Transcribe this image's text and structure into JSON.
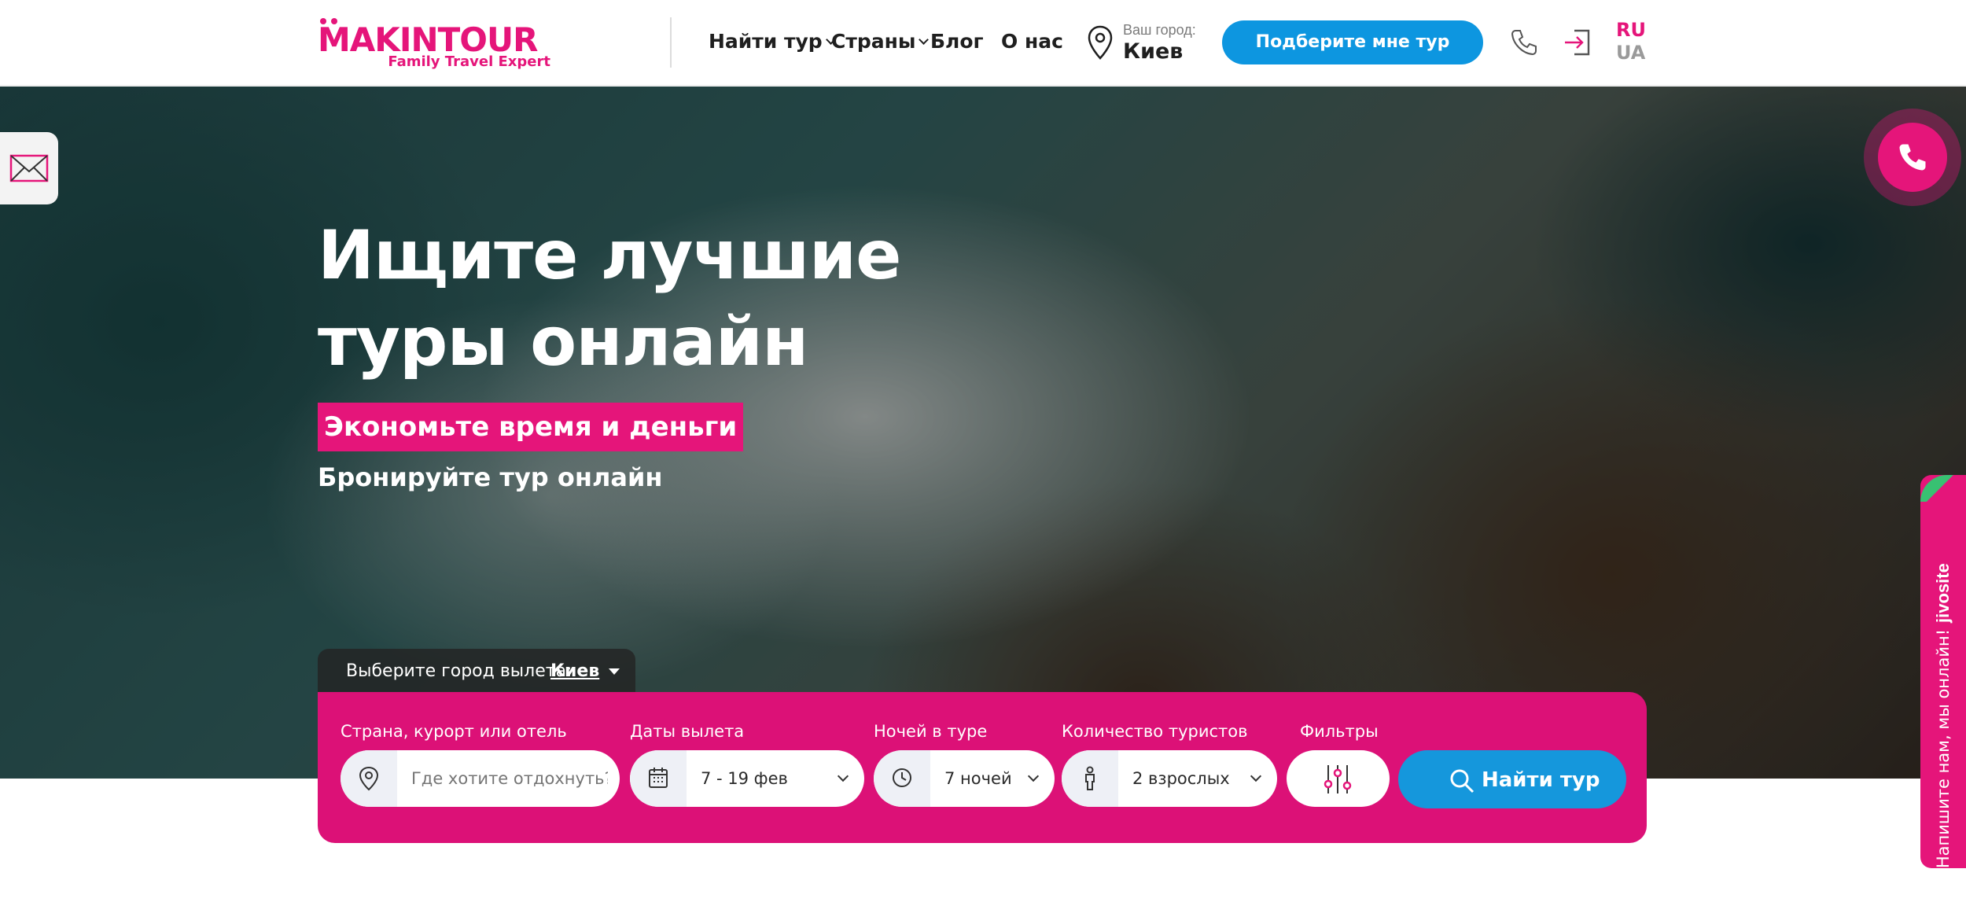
{
  "header": {
    "logo": {
      "name": "MAKINTOUR",
      "tagline": "Family Travel Expert"
    },
    "nav": [
      {
        "label": "Найти тур",
        "has_dropdown": true
      },
      {
        "label": "Страны",
        "has_dropdown": true
      },
      {
        "label": "Блог",
        "has_dropdown": false
      },
      {
        "label": "О нас",
        "has_dropdown": false
      }
    ],
    "city": {
      "label": "Ваш город:",
      "value": "Киев",
      "icon": "map-pin-icon"
    },
    "cta": "Подберите мне тур",
    "icons": [
      "phone-icon",
      "login-icon"
    ],
    "languages": [
      "RU",
      "UA"
    ],
    "active_language": "RU"
  },
  "hero": {
    "title": "Ищите лучшие туры онлайн",
    "badge": "Экономьте время и деньги",
    "subtitle": "Бронируйте тур онлайн"
  },
  "departure": {
    "label": "Выберите город вылета:",
    "value": "Киев"
  },
  "search": {
    "destination": {
      "label": "Страна, курорт или отель",
      "placeholder": "Где хотите отдохнуть?",
      "icon": "map-pin-icon"
    },
    "dates": {
      "label": "Даты вылета",
      "value": "7 - 19 фев",
      "icon": "calendar-icon"
    },
    "nights": {
      "label": "Ночей в туре",
      "value": "7 ночей",
      "icon": "clock-icon"
    },
    "tourists": {
      "label": "Количество туристов",
      "value": "2 взрослых",
      "icon": "person-icon"
    },
    "filters": {
      "label": "Фильтры",
      "icon": "sliders-icon"
    },
    "submit": "Найти тур"
  },
  "widgets": {
    "mail_icon": "mail-icon",
    "phone_fab_icon": "phone-icon",
    "jivo_brand": "jivosite",
    "jivo_message": "Напишите нам, мы онлайн!"
  },
  "colors": {
    "brand_pink": "#e5157a",
    "brand_blue": "#0d96e0",
    "panel_pink": "#dc1177"
  }
}
